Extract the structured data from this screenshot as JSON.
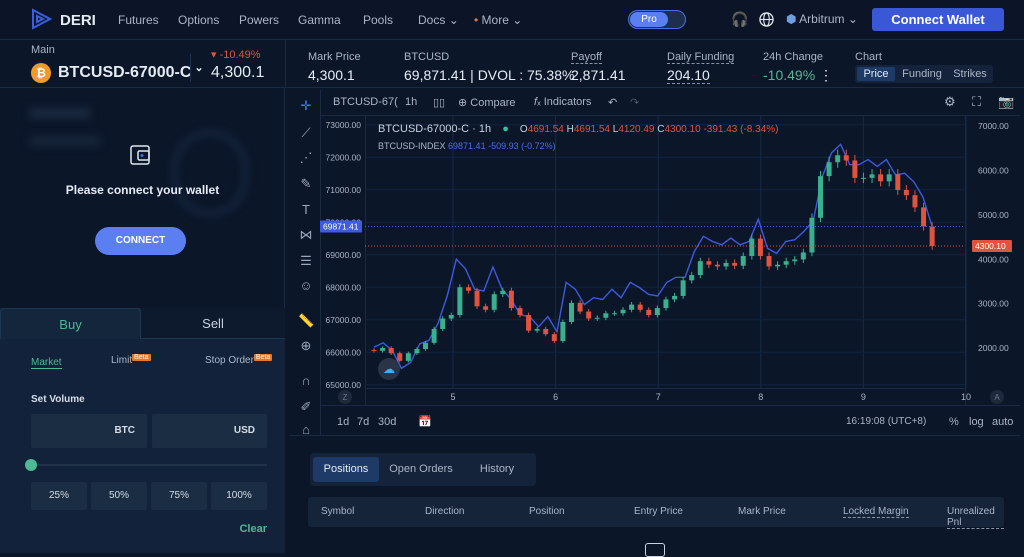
{
  "nav": {
    "brand": "DERI",
    "items": [
      "Futures",
      "Options",
      "Powers",
      "Gamma",
      "Pools",
      "Docs",
      "More"
    ],
    "pro_label": "Pro",
    "network": "Arbitrum",
    "connect_wallet": "Connect Wallet"
  },
  "instrument": {
    "account": "Main",
    "symbol": "BTCUSD-67000-C",
    "change": "-10.49%",
    "price": "4,300.1"
  },
  "stats": {
    "mark_price": {
      "label": "Mark Price",
      "value": "4,300.1"
    },
    "btcusd": {
      "label": "BTCUSD",
      "value": "69,871.41 | DVOL : 75.38%"
    },
    "payoff": {
      "label": "Payoff",
      "value": "2,871.41"
    },
    "daily_funding": {
      "label": "Daily Funding",
      "value": "204.10"
    },
    "change_24h": {
      "label": "24h Change",
      "value": "-10.49%"
    },
    "chart": {
      "label": "Chart",
      "tabs": [
        "Price",
        "Funding",
        "Strikes"
      ],
      "active": "Price"
    }
  },
  "wallet_prompt": {
    "message": "Please connect your wallet",
    "button": "CONNECT"
  },
  "order": {
    "tabs": [
      "Buy",
      "Sell"
    ],
    "types": [
      "Market",
      "Limit",
      "Stop Order"
    ],
    "beta": "Beta",
    "set_volume": "Set Volume",
    "unit1": "BTC",
    "unit2": "USD",
    "slider_value": 0,
    "percents": [
      "25%",
      "50%",
      "75%",
      "100%"
    ],
    "clear": "Clear"
  },
  "chart_toolbar": {
    "symbol": "BTCUSD-67(",
    "interval": "1h",
    "compare": "Compare",
    "indicators": "Indicators"
  },
  "chart_bottom": {
    "ranges": [
      "1d",
      "7d",
      "30d"
    ],
    "time": "16:19:08 (UTC+8)",
    "percent": "%",
    "log": "log",
    "auto": "auto"
  },
  "chart_data": {
    "type": "candlestick",
    "legend": {
      "symbol": "BTCUSD-67000-C",
      "interval": "1h",
      "o": "4691.54",
      "h": "4691.54",
      "l": "4120.49",
      "c": "4300.10",
      "chg": "-391.43 (-8.34%)",
      "index_name": "BTCUSD-INDEX",
      "index_value": "69871.41",
      "index_chg": "-509.93 (-0.72%)"
    },
    "x_ticks": [
      "5",
      "6",
      "7",
      "8",
      "9",
      "10"
    ],
    "x_range": [
      4.23,
      9.67
    ],
    "left_axis": {
      "ticks": [
        "73000.00",
        "72000.00",
        "71000.00",
        "70000.00",
        "69000.00",
        "68000.00",
        "67000.00",
        "66000.00",
        "65000.00"
      ],
      "ylim": [
        64900,
        73300
      ],
      "last_label": "69871.41"
    },
    "right_axis": {
      "ticks": [
        "7000.00",
        "6000.00",
        "5000.00",
        "4000.00",
        "3000.00",
        "2000.00"
      ],
      "ylim": [
        1100,
        7250
      ],
      "last_label": "4300.10"
    },
    "option_closes": [
      1938,
      2001,
      1883,
      1712,
      1883,
      1977,
      2118,
      2430,
      2665,
      2744,
      3369,
      3292,
      2940,
      2862,
      3214,
      3292,
      2900,
      2744,
      2392,
      2430,
      2313,
      2158,
      2588,
      3017,
      2822,
      2665,
      2682,
      2783,
      2783,
      2862,
      2979,
      2862,
      2744,
      2900,
      3096,
      3174,
      3526,
      3644,
      3956,
      3878,
      3839,
      3918,
      3855,
      4073,
      4465,
      4073,
      3839,
      3878,
      3956,
      3996,
      4153,
      4935,
      5873,
      6186,
      6343,
      6226,
      5834,
      5834,
      5913,
      5756,
      5913,
      5561,
      5443,
      5169,
      4740,
      4300
    ],
    "index_values": [
      66156,
      66291,
      66050,
      65504,
      65684,
      66260,
      66364,
      66890,
      67731,
      68866,
      68570,
      67940,
      67887,
      68622,
      67940,
      67624,
      67152,
      67100,
      66785,
      67100,
      66628,
      68150,
      67940,
      67467,
      67677,
      67624,
      67940,
      67677,
      68150,
      67992,
      67782,
      67731,
      68150,
      68307,
      68307,
      69094,
      69567,
      69409,
      69305,
      69514,
      69305,
      69409,
      70094,
      69199,
      69041,
      69409,
      69462,
      69724,
      70039,
      71403,
      72135,
      72398,
      71771,
      71771,
      71929,
      71718,
      71929,
      71456,
      71508,
      71245,
      70773,
      69871
    ],
    "colors": {
      "up": "#3bb08f",
      "down": "#e0533f",
      "index": "#3d5ae0"
    }
  },
  "positions": {
    "tabs": [
      "Positions",
      "Open Orders",
      "History"
    ],
    "columns": [
      "Symbol",
      "Direction",
      "Position",
      "Entry Price",
      "Mark Price",
      "Locked Margin",
      "Unrealized Pnl"
    ]
  }
}
